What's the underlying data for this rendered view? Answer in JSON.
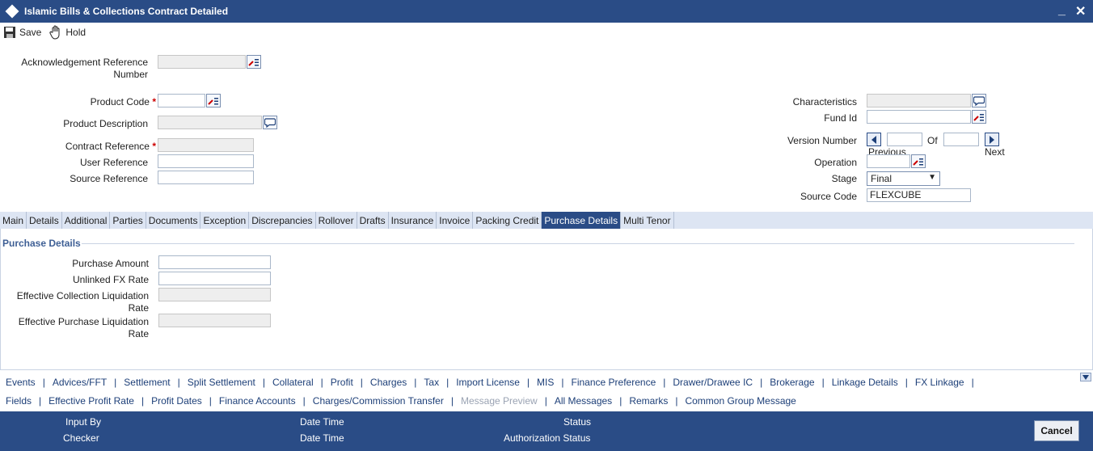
{
  "window": {
    "title": "Islamic Bills & Collections Contract Detailed",
    "minimize": "_",
    "close": "✕"
  },
  "toolbar": {
    "save_label": "Save",
    "hold_label": "Hold"
  },
  "form": {
    "ack_ref_label_1": "Acknowledgement Reference",
    "ack_ref_label_2": "Number",
    "product_code_label": "Product Code",
    "product_desc_label": "Product Description",
    "contract_ref_label": "Contract Reference",
    "user_ref_label": "User Reference",
    "source_ref_label": "Source Reference",
    "required_mark": "*",
    "characteristics_label": "Characteristics",
    "fund_id_label": "Fund Id",
    "version_number_label": "Version Number",
    "of_label": "Of",
    "previous_label": "Previous",
    "next_label": "Next",
    "operation_label": "Operation",
    "stage_label": "Stage",
    "stage_value": "Final",
    "source_code_label": "Source Code",
    "source_code_value": "FLEXCUBE"
  },
  "tabs": [
    {
      "label": "Main",
      "active": false
    },
    {
      "label": "Details",
      "active": false
    },
    {
      "label": "Additional",
      "active": false
    },
    {
      "label": "Parties",
      "active": false
    },
    {
      "label": "Documents",
      "active": false
    },
    {
      "label": "Exception",
      "active": false
    },
    {
      "label": "Discrepancies",
      "active": false
    },
    {
      "label": "Rollover",
      "active": false
    },
    {
      "label": "Drafts",
      "active": false
    },
    {
      "label": "Insurance",
      "active": false
    },
    {
      "label": "Invoice",
      "active": false
    },
    {
      "label": "Packing Credit",
      "active": false
    },
    {
      "label": "Purchase Details",
      "active": true
    },
    {
      "label": "Multi Tenor",
      "active": false
    }
  ],
  "purchase": {
    "section_title": "Purchase Details",
    "purchase_amount_label": "Purchase Amount",
    "unlinked_fx_label": "Unlinked FX Rate",
    "eff_coll_label_1": "Effective Collection Liquidation",
    "eff_coll_label_2": "Rate",
    "eff_purch_label_1": "Effective Purchase Liquidation",
    "eff_purch_label_2": "Rate"
  },
  "links_row1": [
    {
      "label": "Events",
      "disabled": false
    },
    {
      "label": "Advices/FFT",
      "disabled": false
    },
    {
      "label": "Settlement",
      "disabled": false
    },
    {
      "label": "Split Settlement",
      "disabled": false
    },
    {
      "label": "Collateral",
      "disabled": false
    },
    {
      "label": "Profit",
      "disabled": false
    },
    {
      "label": "Charges",
      "disabled": false
    },
    {
      "label": "Tax",
      "disabled": false
    },
    {
      "label": "Import License",
      "disabled": false
    },
    {
      "label": "MIS",
      "disabled": false
    },
    {
      "label": "Finance Preference",
      "disabled": false
    },
    {
      "label": "Drawer/Drawee IC",
      "disabled": false
    },
    {
      "label": "Brokerage",
      "disabled": false
    },
    {
      "label": "Linkage Details",
      "disabled": false
    },
    {
      "label": "FX Linkage",
      "disabled": false
    }
  ],
  "links_row2": [
    {
      "label": "Fields",
      "disabled": false
    },
    {
      "label": "Effective Profit Rate",
      "disabled": false
    },
    {
      "label": "Profit Dates",
      "disabled": false
    },
    {
      "label": "Finance Accounts",
      "disabled": false
    },
    {
      "label": "Charges/Commission Transfer",
      "disabled": false
    },
    {
      "label": "Message Preview",
      "disabled": true
    },
    {
      "label": "All Messages",
      "disabled": false
    },
    {
      "label": "Remarks",
      "disabled": false
    },
    {
      "label": "Common Group Message",
      "disabled": false
    }
  ],
  "link_separator": "|",
  "footer": {
    "input_by": "Input By",
    "checker": "Checker",
    "date_time_1": "Date Time",
    "date_time_2": "Date Time",
    "status": "Status",
    "auth_status": "Authorization Status",
    "cancel_label": "Cancel"
  },
  "colors": {
    "header_blue": "#2a4c86",
    "tab_bar": "#dde5f3",
    "link_blue": "#1d3f78",
    "required_red": "#cc0000"
  }
}
